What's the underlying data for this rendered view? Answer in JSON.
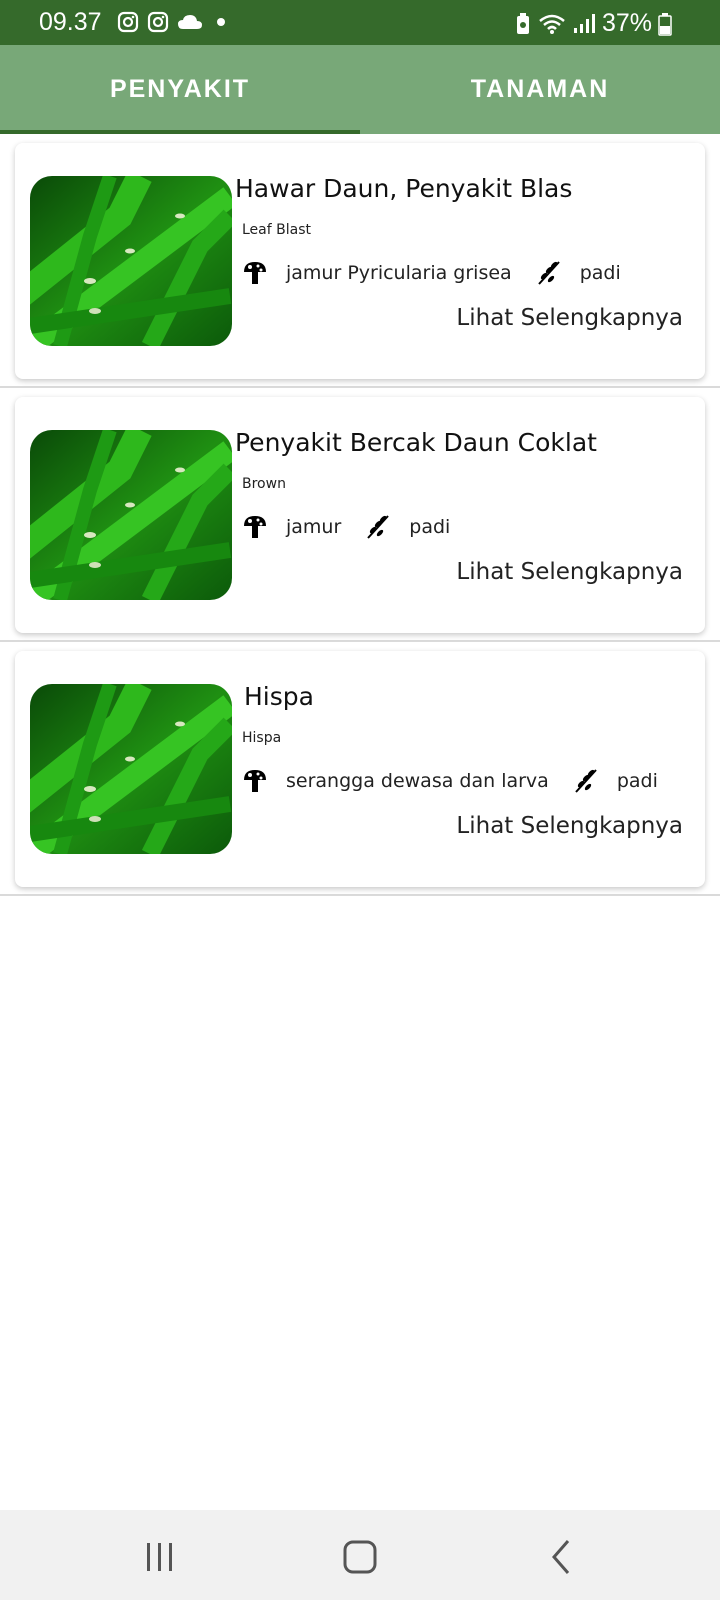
{
  "status_bar": {
    "time": "09.37",
    "battery": "37%"
  },
  "tabs": [
    {
      "label": "PENYAKIT",
      "active": true
    },
    {
      "label": "TANAMAN",
      "active": false
    }
  ],
  "diseases": [
    {
      "title": "Hawar Daun, Penyakit Blas",
      "subtitle": "Leaf Blast",
      "cause": "jamur Pyricularia grisea",
      "plant": "padi",
      "more": "Lihat Selengkapnya"
    },
    {
      "title": "Penyakit Bercak Daun Coklat",
      "subtitle": "Brown",
      "cause": "jamur",
      "plant": "padi",
      "more": "Lihat Selengkapnya"
    },
    {
      "title": "Hispa",
      "subtitle": "Hispa",
      "cause": "serangga dewasa dan larva",
      "plant": "padi",
      "more": "Lihat Selengkapnya"
    }
  ],
  "colors": {
    "status_bar": "#356a2b",
    "tab_bar": "#78a878",
    "indicator": "#356a2b"
  }
}
